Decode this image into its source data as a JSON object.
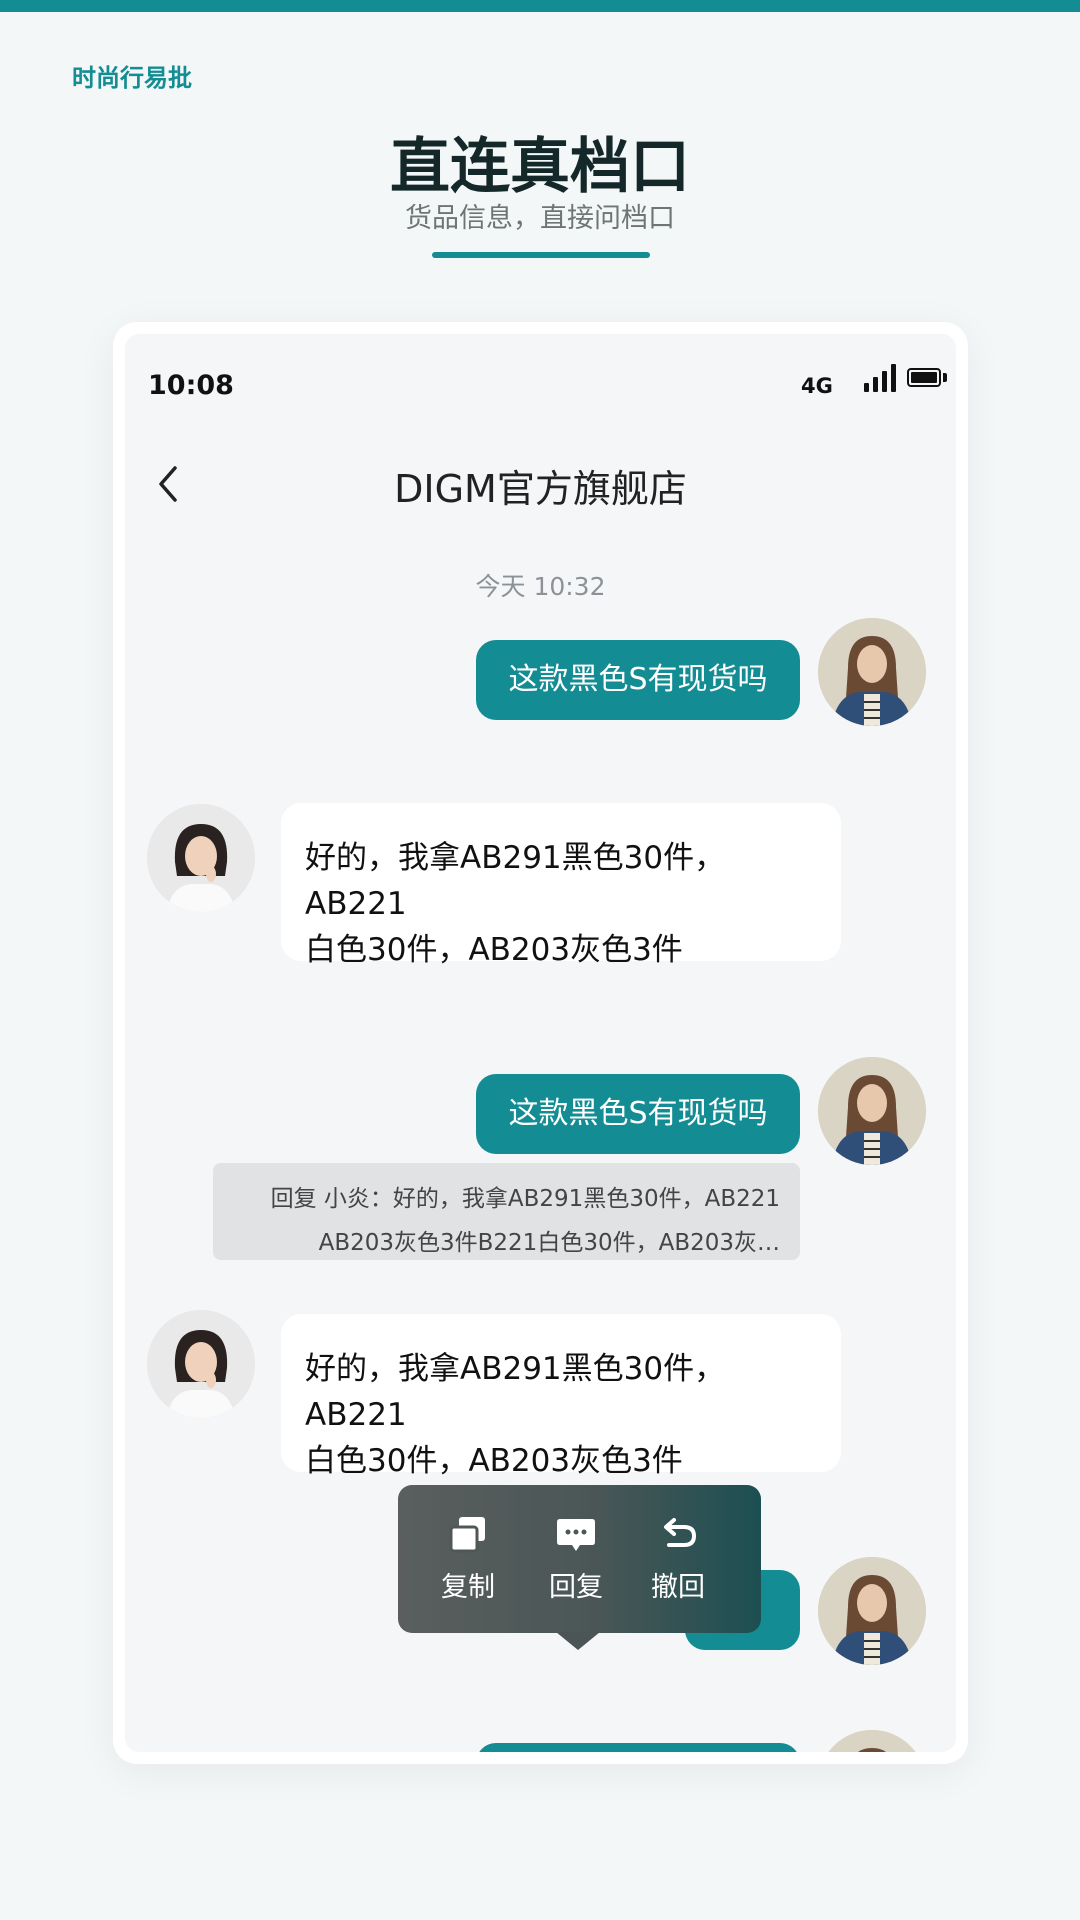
{
  "header": {
    "brand": "时尚行易批",
    "headline": "直连真档口",
    "subheadline": "货品信息，直接问档口"
  },
  "status_bar": {
    "time": "10:08",
    "network": "4G"
  },
  "chat": {
    "title": "DIGM官方旗舰店",
    "timestamp": "今天 10:32",
    "messages": [
      {
        "side": "out",
        "text": "这款黑色S有现货吗"
      },
      {
        "side": "in",
        "lines": [
          "好的，我拿AB291黑色30件，AB221",
          "白色30件，AB203灰色3件"
        ]
      },
      {
        "side": "out",
        "text": "这款黑色S有现货吗"
      },
      {
        "quote": {
          "line1": "回复 小炎：好的，我拿AB291黑色30件，AB221",
          "line2": "AB203灰色3件B221白色30件，AB203灰…"
        }
      },
      {
        "side": "in",
        "lines": [
          "好的，我拿AB291黑色30件，AB221",
          "白色30件，AB203灰色3件"
        ]
      }
    ]
  },
  "context_menu": {
    "items": [
      {
        "label": "复制",
        "icon": "copy-icon"
      },
      {
        "label": "回复",
        "icon": "reply-icon"
      },
      {
        "label": "撤回",
        "icon": "undo-icon"
      }
    ]
  },
  "colors": {
    "accent": "#138d93",
    "page_background": "#f4f7f7",
    "chat_background": "#f5f6f8"
  }
}
